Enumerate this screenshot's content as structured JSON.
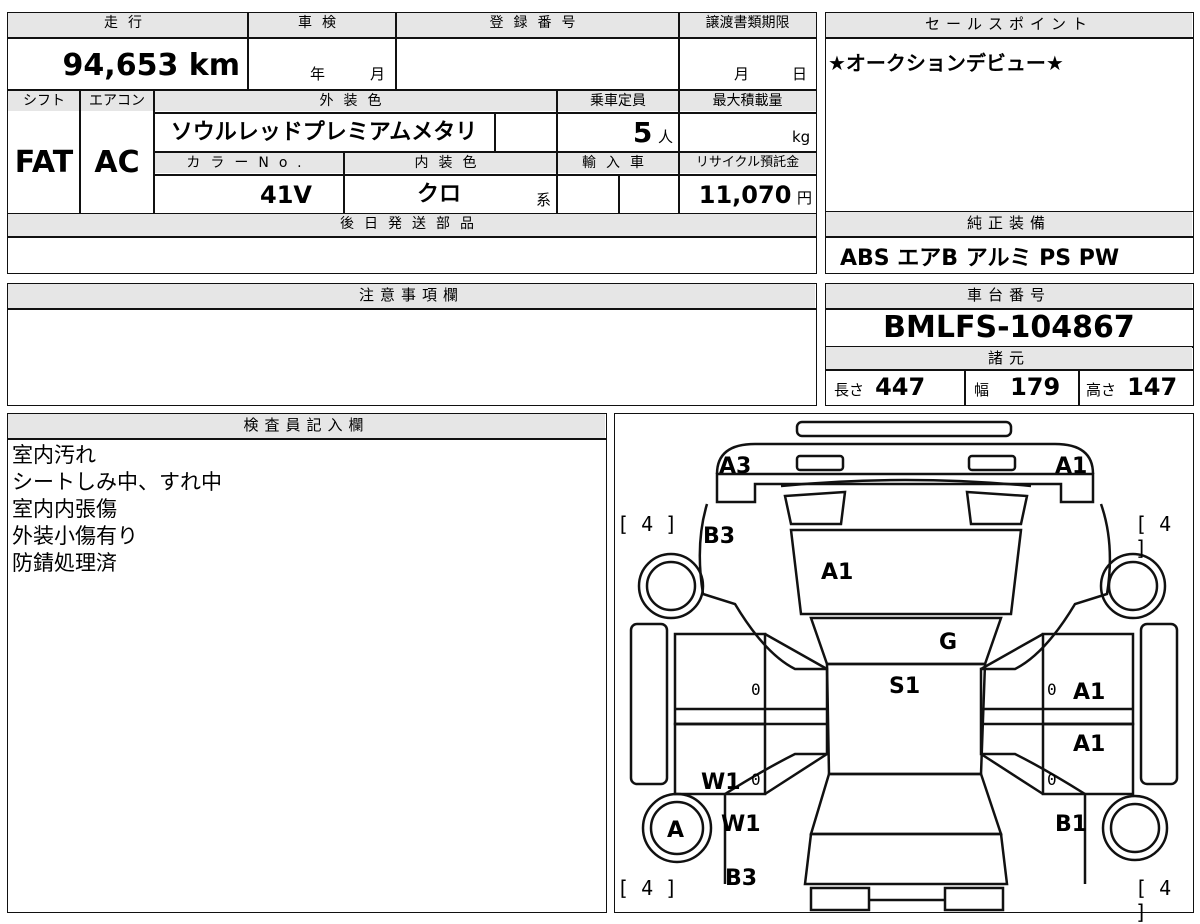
{
  "top_table": {
    "headers_row1": [
      "走行",
      "車検",
      "登録番号",
      "譲渡書類期限"
    ],
    "mileage": "94,653",
    "mileage_unit": "km",
    "shaken_year": "年",
    "shaken_month": "月",
    "transfer_month": "月",
    "transfer_day": "日",
    "headers_row2": [
      "シフト",
      "エアコン",
      "外装色",
      "乗車定員",
      "最大積載量"
    ],
    "shift": "FAT",
    "aircon": "AC",
    "exterior_color": "ソウルレッドプレミアムメタリ",
    "capacity": "5",
    "capacity_unit": "人",
    "max_load_unit": "kg",
    "headers_row3": [
      "カラーNo.",
      "内装色",
      "輸入車",
      "リサイクル預託金"
    ],
    "color_no": "41V",
    "interior_color": "クロ",
    "interior_suffix": "系",
    "recycle_fee": "11,070",
    "recycle_unit": "円",
    "later_parts_header": "後日発送部品"
  },
  "sales_point": {
    "header": "セールスポイント",
    "text": "★オークションデビュー★"
  },
  "equipment": {
    "header": "純正装備",
    "items": "ABS エアB アルミ PS PW"
  },
  "notes": {
    "header": "注意事項欄"
  },
  "chassis": {
    "header": "車台番号",
    "number": "BMLFS-104867"
  },
  "dimensions": {
    "header": "諸元",
    "length_label": "長さ",
    "length": "447",
    "width_label": "幅",
    "width": "179",
    "height_label": "高さ",
    "height": "147"
  },
  "inspector": {
    "header": "検査員記入欄",
    "lines": [
      "室内汚れ",
      "シートしみ中、すれ中",
      "室内内張傷",
      "外装小傷有り",
      "防錆処理済"
    ]
  },
  "car_diagram": {
    "tire_marks": [
      "[ 4 ]",
      "[ 4 ]",
      "[ 4 ]",
      "[ 4 ]"
    ],
    "codes": {
      "front_left": "A3",
      "front_right": "A1",
      "left_fender": "B3",
      "hood": "A1",
      "glass": "G",
      "roof": "S1",
      "right_front_door": "A1",
      "right_rear_door": "A1",
      "left_rear_door": "W1",
      "left_quarter": "W1",
      "left_wheel": "A",
      "right_quarter": "B1",
      "rear_left": "B3",
      "door_zero_1": "0",
      "door_zero_2": "0",
      "door_zero_3": "0",
      "door_zero_4": "0"
    }
  }
}
